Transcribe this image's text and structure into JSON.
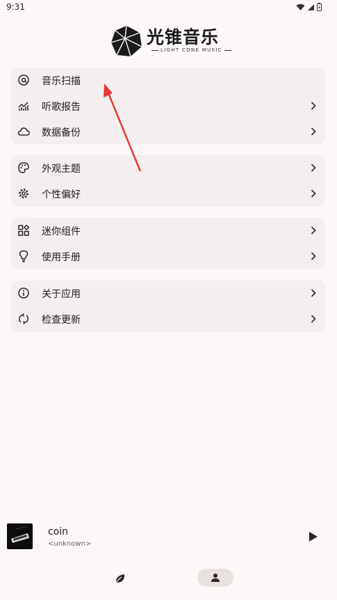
{
  "status_bar": {
    "time": "9:31"
  },
  "logo": {
    "title": "光锥音乐",
    "subtitle": "LIGHT CONE MUSIC"
  },
  "groups": [
    {
      "items": [
        {
          "label": "音乐扫描",
          "icon": "at-sign-icon",
          "chevron": false
        },
        {
          "label": "听歌报告",
          "icon": "chart-icon",
          "chevron": true
        },
        {
          "label": "数据备份",
          "icon": "cloud-icon",
          "chevron": true
        }
      ]
    },
    {
      "items": [
        {
          "label": "外观主题",
          "icon": "palette-icon",
          "chevron": true
        },
        {
          "label": "个性偏好",
          "icon": "gear-icon",
          "chevron": true
        }
      ]
    },
    {
      "items": [
        {
          "label": "迷你组件",
          "icon": "widgets-icon",
          "chevron": true
        },
        {
          "label": "使用手册",
          "icon": "lightbulb-icon",
          "chevron": true
        }
      ]
    },
    {
      "items": [
        {
          "label": "关于应用",
          "icon": "info-icon",
          "chevron": true
        },
        {
          "label": "检查更新",
          "icon": "sync-icon",
          "chevron": true
        }
      ]
    }
  ],
  "player": {
    "title": "coin",
    "artist": "<unknown>"
  },
  "bottom_nav": {
    "items": [
      "leaf-icon",
      "profile-icon"
    ],
    "selected": "profile-icon"
  },
  "colors": {
    "background": "#fcf8f7",
    "card": "#f4efee",
    "arrow": "#e53935",
    "nav_pill": "#e9e1df"
  }
}
